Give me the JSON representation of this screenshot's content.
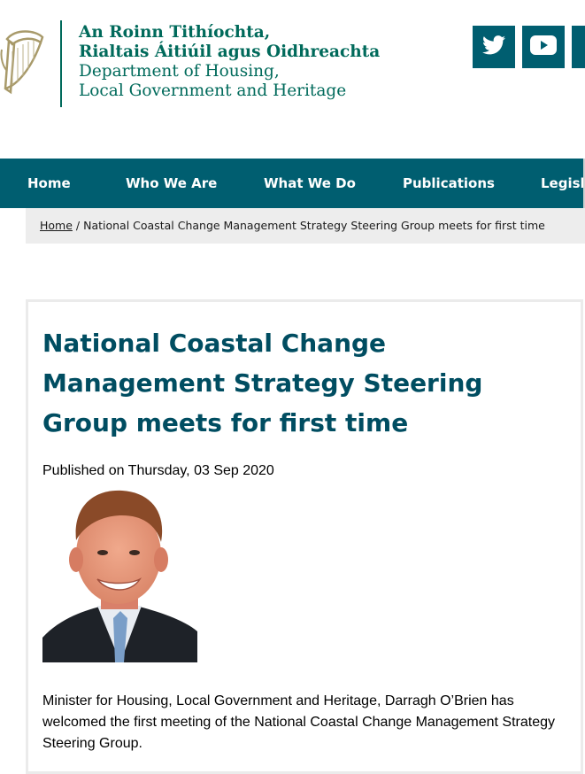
{
  "header": {
    "dept_irish_line1": "An Roinn Tithíochta,",
    "dept_irish_line2": "Rialtais Áitiúil agus Oidhreachta",
    "dept_english_line1": "Department of Housing,",
    "dept_english_line2": "Local Government and Heritage",
    "social": [
      "twitter-icon",
      "youtube-icon"
    ]
  },
  "nav": {
    "items": [
      "Home",
      "Who We Are",
      "What We Do",
      "Publications",
      "Legislat"
    ]
  },
  "breadcrumb": {
    "home": "Home",
    "separator": " / ",
    "current": "National Coastal Change Management Strategy Steering Group meets for first time"
  },
  "article": {
    "title": "National Coastal Change Management Strategy Steering Group meets for first time",
    "published": "Published on Thursday, 03 Sep 2020",
    "body": "Minister for Housing, Local Government and Heritage, Darragh O’Brien has welcomed the first meeting of the National Coastal Change Management Strategy Steering Group."
  },
  "colors": {
    "brand_green": "#006a5b",
    "nav_bg": "#005e70",
    "title": "#004d61",
    "breadcrumb_bg": "#ededed"
  }
}
